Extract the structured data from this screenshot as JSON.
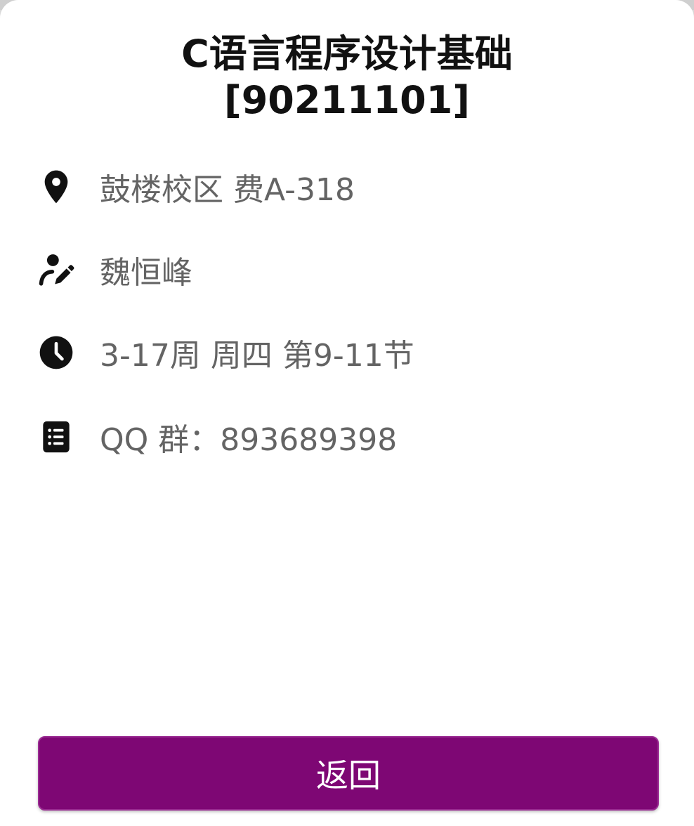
{
  "course": {
    "title_line1": "C语言程序设计基础",
    "title_line2": "[90211101]"
  },
  "details": [
    {
      "icon": "location-pin-icon",
      "text": "鼓楼校区 费A-318"
    },
    {
      "icon": "teacher-edit-icon",
      "text": "魏恒峰"
    },
    {
      "icon": "clock-icon",
      "text": "3-17周 周四 第9-11节"
    },
    {
      "icon": "list-note-icon",
      "text": "QQ 群：893689398"
    }
  ],
  "actions": {
    "back_label": "返回"
  },
  "colors": {
    "accent": "#7e0774",
    "title_text": "#111111",
    "detail_text": "#646464",
    "icon": "#111111"
  }
}
